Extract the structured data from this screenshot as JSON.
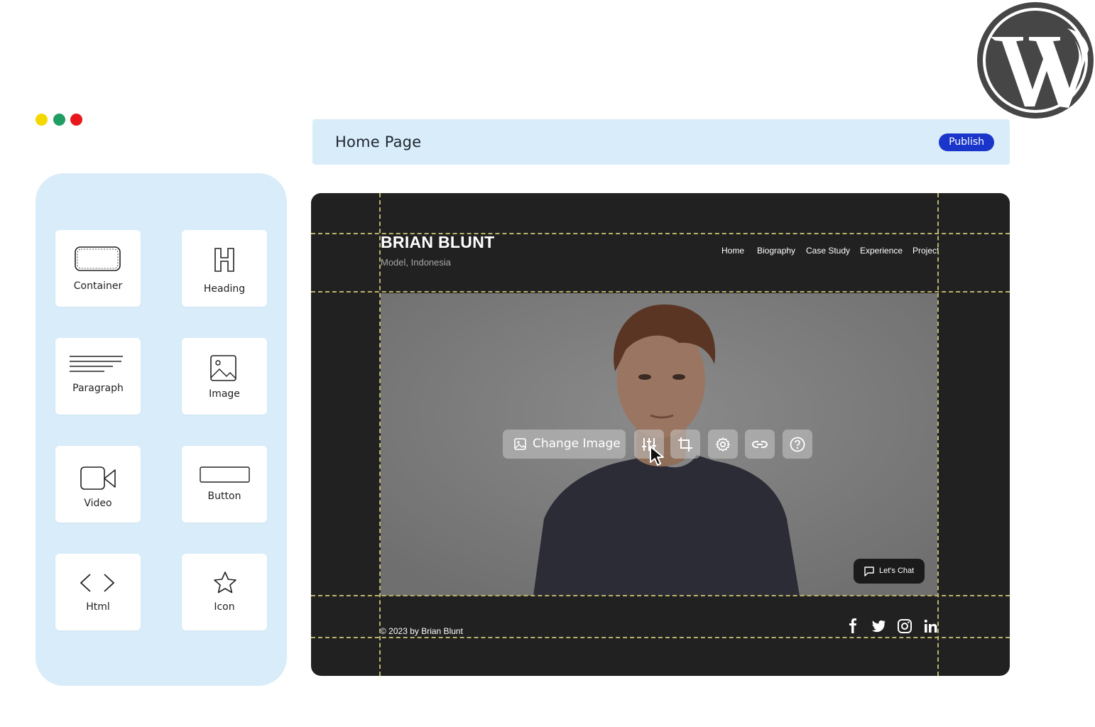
{
  "window_dots": {
    "colors": [
      "#f5d800",
      "#1f9d63",
      "#e8171b"
    ]
  },
  "topbar": {
    "title": "Home Page",
    "publish_label": "Publish"
  },
  "widgets": [
    {
      "label": "Container",
      "icon": "container-icon"
    },
    {
      "label": "Heading",
      "icon": "heading-icon"
    },
    {
      "label": "Paragraph",
      "icon": "paragraph-icon"
    },
    {
      "label": "Image",
      "icon": "image-icon"
    },
    {
      "label": "Video",
      "icon": "video-icon"
    },
    {
      "label": "Button",
      "icon": "button-icon"
    },
    {
      "label": "Html",
      "icon": "code-icon"
    },
    {
      "label": "Icon",
      "icon": "star-icon"
    }
  ],
  "site": {
    "name": "BRIAN BLUNT",
    "subtitle": "Model, Indonesia",
    "nav": [
      "Home",
      "Biography",
      "Case Study",
      "Experience",
      "Project"
    ],
    "footer_text": "© 2023 by Brian Blunt",
    "social_icons": [
      "facebook-icon",
      "twitter-icon",
      "instagram-icon",
      "linkedin-icon"
    ],
    "chat_label": "Let's Chat"
  },
  "image_toolbar": {
    "change_image_label": "Change Image",
    "tools": [
      "adjust-icon",
      "crop-icon",
      "settings-icon",
      "link-icon",
      "help-icon"
    ]
  },
  "colors": {
    "panel_bg": "#d9ecf9",
    "publish_bg": "#1a35c9",
    "canvas_bg": "#212121",
    "guide": "#b9b36a"
  }
}
